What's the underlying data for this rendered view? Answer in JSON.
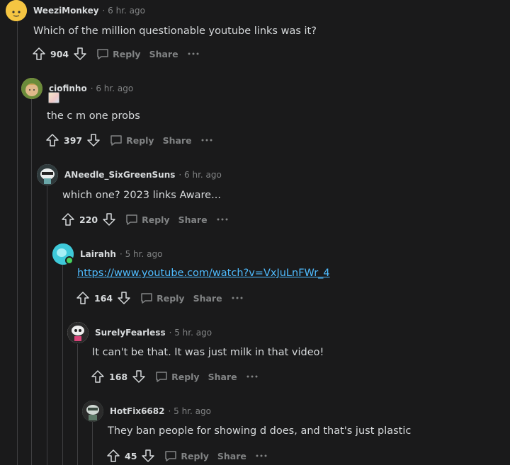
{
  "comments": [
    {
      "username": "WeeziMonkey",
      "time": "· 6 hr. ago",
      "body": "Which of the million questionable youtube links was it?",
      "votes": "904",
      "reply_label": "Reply",
      "share_label": "Share",
      "avatar_color": "#f5c542"
    },
    {
      "username": "ciofinho",
      "time": "· 6 hr. ago",
      "body": "the c m one probs",
      "votes": "397",
      "reply_label": "Reply",
      "share_label": "Share",
      "avatar_color": "#c9a36b"
    },
    {
      "username": "ANeedle_SixGreenSuns",
      "time": "· 6 hr. ago",
      "body": "which one? 2023 links Aware...",
      "votes": "220",
      "reply_label": "Reply",
      "share_label": "Share",
      "avatar_color": "#9fb0b4"
    },
    {
      "username": "Lairahh",
      "time": "· 5 hr. ago",
      "body": "https://www.youtube.com/watch?v=VxJuLnFWr_4",
      "votes": "164",
      "reply_label": "Reply",
      "share_label": "Share",
      "avatar_color": "#3ec9d9",
      "online_color": "#46d160"
    },
    {
      "username": "SurelyFearless",
      "time": "· 5 hr. ago",
      "body": "It can't be that. It was just milk in that video!",
      "votes": "168",
      "reply_label": "Reply",
      "share_label": "Share",
      "avatar_color": "#d6d6d6"
    },
    {
      "username": "HotFix6682",
      "time": "· 5 hr. ago",
      "body": "They ban people for showing d does, and that's just plastic",
      "votes": "45",
      "reply_label": "Reply",
      "share_label": "Share",
      "avatar_color": "#6f8f7e"
    }
  ],
  "colors": {
    "background": "#1a1a1b",
    "text": "#d7dadc",
    "meta": "#818384",
    "link": "#4fbcff",
    "thread_line": "#3f3f41"
  }
}
